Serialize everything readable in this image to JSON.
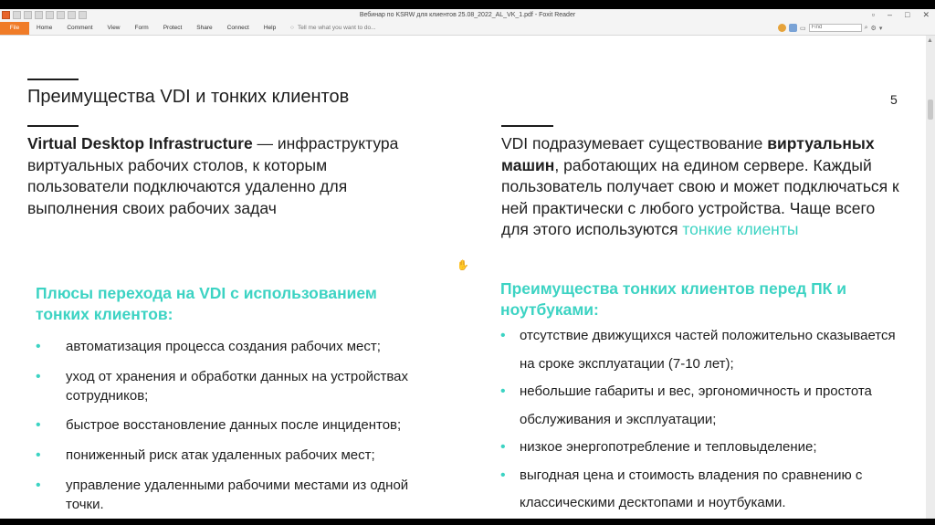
{
  "app": {
    "window_title": "Вебинар по KSRW для клиентов 25.08_2022_AL_VK_1.pdf - Foxit Reader"
  },
  "menu": {
    "file": "File",
    "tabs": [
      "Home",
      "Comment",
      "View",
      "Form",
      "Protect",
      "Share",
      "Connect",
      "Help"
    ],
    "tell_me": "Tell me what you want to do...",
    "find_placeholder": "Find"
  },
  "slide": {
    "title": "Преимущества VDI и тонких клиентов",
    "page_number": "5",
    "left": {
      "intro_bold": "Virtual Desktop Infrastructure",
      "intro_rest": " — инфраструктура виртуальных рабочих столов, к которым пользователи подключаются удаленно для выполнения своих рабочих задач",
      "heading": "Плюсы перехода на VDI с использованием тонких клиентов:",
      "bullets": [
        "автоматизация процесса создания рабочих мест;",
        "уход от хранения и обработки данных на устройствах сотрудников;",
        "быстрое восстановление данных после инцидентов;",
        "пониженный риск атак удаленных рабочих мест;",
        "управление удаленными рабочими местами из одной точки."
      ]
    },
    "right": {
      "intro_1": "VDI подразумевает существование ",
      "intro_bold": "виртуальных машин",
      "intro_2": ", работающих на едином сервере. Каждый пользователь получает свою и может подключаться к ней практически с любого устройства. Чаще всего для этого используются ",
      "intro_teal": "тонкие клиенты",
      "heading": "Преимущества тонких клиентов перед ПК и ноутбуками:",
      "bullets": [
        "отсутствие движущихся частей положительно сказывается на сроке эксплуатации (7-10 лет);",
        "небольшие габариты и вес, эргономичность и простота обслуживания и эксплуатации;",
        "низкое энергопотребление и тепловыделение;",
        "выгодная цена и стоимость владения по сравнению с классическими десктопами и ноутбуками."
      ]
    }
  }
}
